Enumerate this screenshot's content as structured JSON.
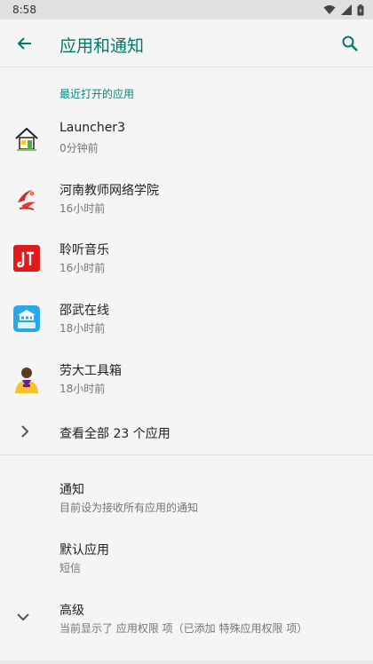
{
  "status": {
    "time": "8:58"
  },
  "appbar": {
    "title": "应用和通知",
    "back_icon": "arrow-left-icon",
    "search_icon": "search-icon"
  },
  "recent": {
    "header": "最近打开的应用",
    "items": [
      {
        "name": "Launcher3",
        "time": "0分钟前",
        "icon": "house-icon"
      },
      {
        "name": "河南教师网络学院",
        "time": "16小时前",
        "icon": "red-logo-icon"
      },
      {
        "name": "聆听音乐",
        "time": "16小时前",
        "icon": "music-app-icon"
      },
      {
        "name": "邵武在线",
        "time": "18小时前",
        "icon": "city-app-icon"
      },
      {
        "name": "劳大工具箱",
        "time": "18小时前",
        "icon": "avatar-icon"
      }
    ],
    "see_all": "查看全部 23 个应用"
  },
  "settings": [
    {
      "title": "通知",
      "summary": "目前设为接收所有应用的通知"
    },
    {
      "title": "默认应用",
      "summary": "短信"
    },
    {
      "title": "高级",
      "summary": "当前显示了 应用权限 项（已添加 特殊应用权限 项）"
    }
  ],
  "colors": {
    "accent": "#00796b",
    "background": "#f5f5f5"
  }
}
